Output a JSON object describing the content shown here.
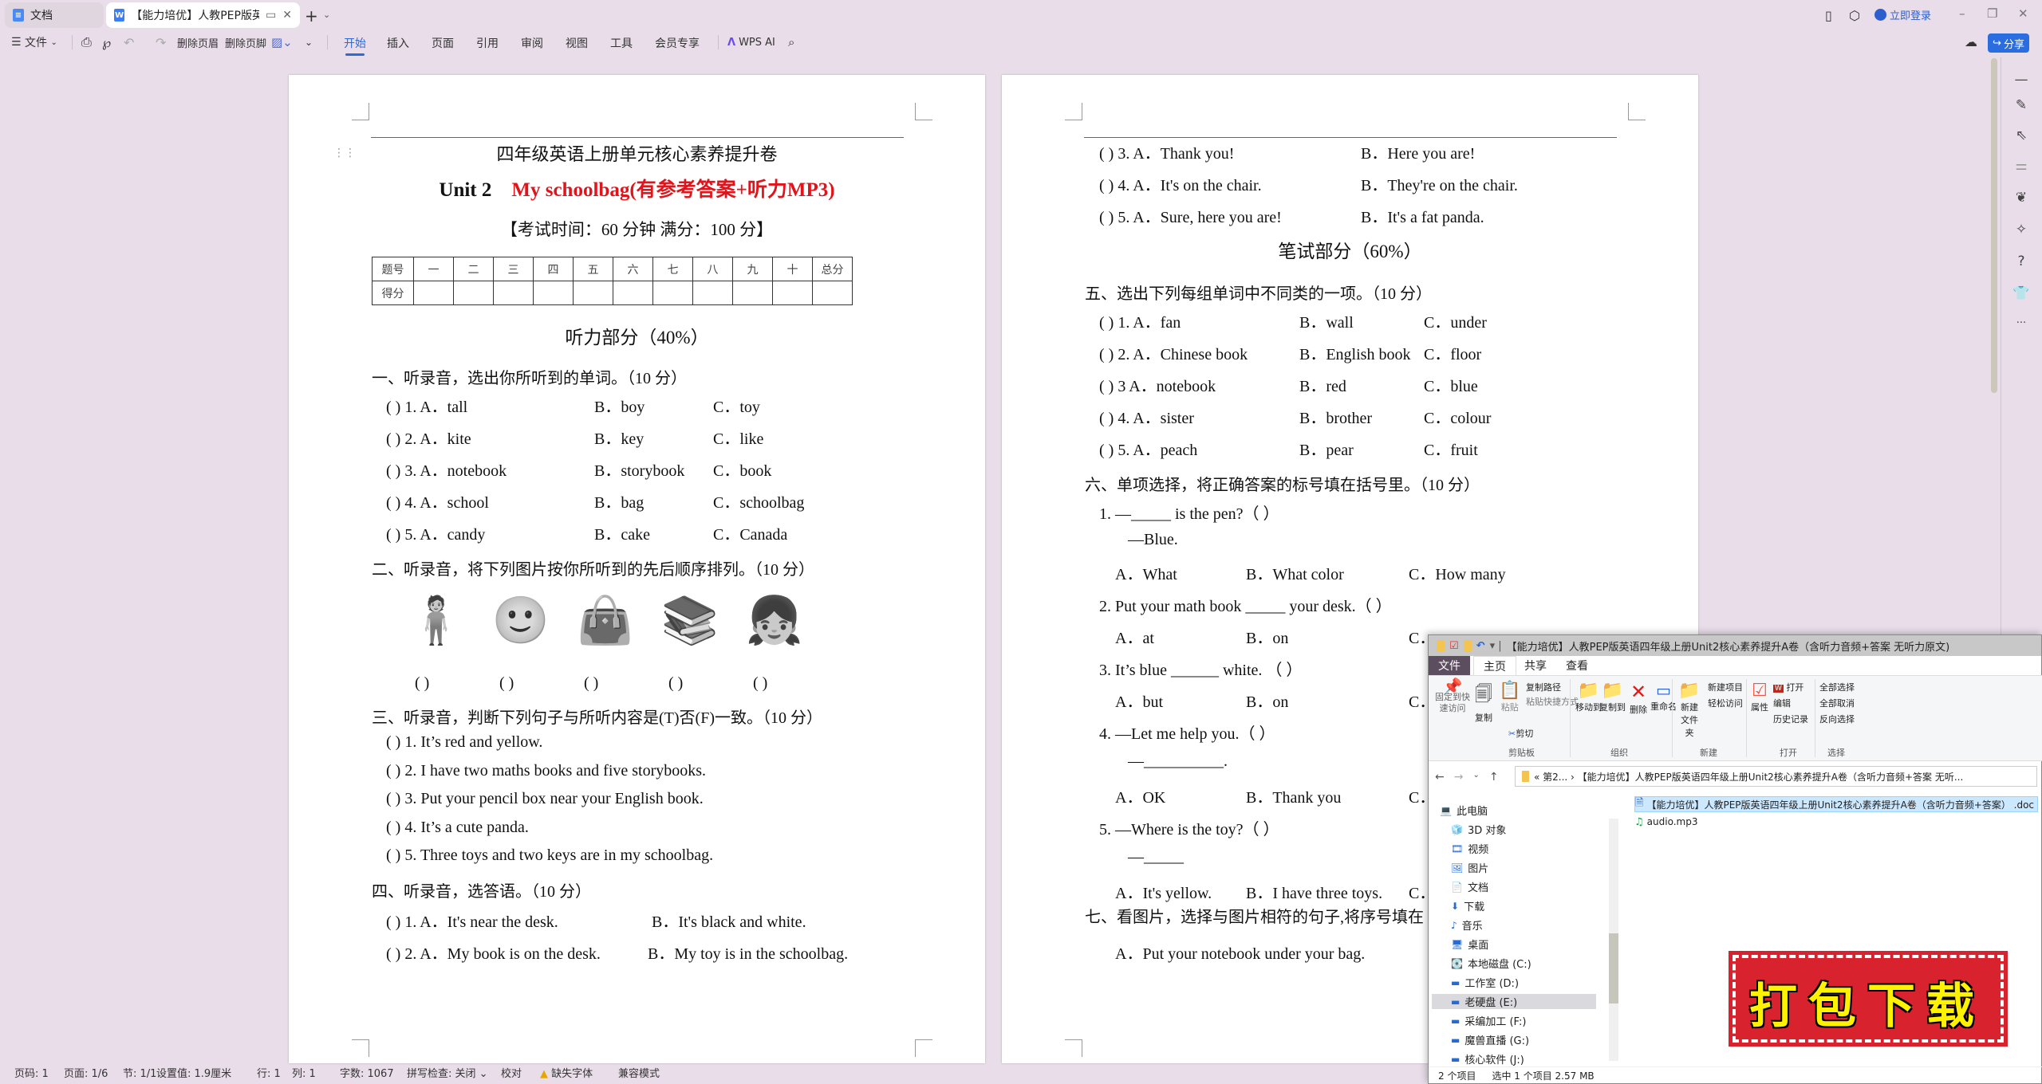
{
  "tabs": [
    {
      "label": "文档",
      "icon": "docs-icon"
    },
    {
      "label": "【能力培优】人教PEP版英语四",
      "icon": "wps-word-icon"
    }
  ],
  "titlebar": {
    "login": "立即登录",
    "share": "分享"
  },
  "toolbar": {
    "file_menu": "文件",
    "delete_header": "删除页眉",
    "delete_footer": "删除页脚",
    "menus": [
      "开始",
      "插入",
      "页面",
      "引用",
      "审阅",
      "视图",
      "工具",
      "会员专享"
    ],
    "active_menu": "开始",
    "wps_ai": "WPS AI"
  },
  "page1": {
    "title": "四年级英语上册单元核心素养提升卷",
    "unit_black": "Unit 2",
    "unit_red": "My    schoolbag(有参考答案+听力MP3)",
    "exam_info": "【考试时间：60 分钟  满分：100 分】",
    "score_table": {
      "headers": [
        "题号",
        "一",
        "二",
        "三",
        "四",
        "五",
        "六",
        "七",
        "八",
        "九",
        "十",
        "总分"
      ],
      "row_label": "得分"
    },
    "listening_heading": "听力部分（40%）",
    "sec1": "一、听录音，选出你所听到的单词。（10 分）",
    "sec1_items": [
      {
        "n": "(      ) 1. A．tall",
        "b": "B．boy",
        "c": "C．toy"
      },
      {
        "n": "(      ) 2. A．kite",
        "b": "B．key",
        "c": "C．like"
      },
      {
        "n": "(      ) 3. A．notebook",
        "b": "B．storybook",
        "c": "C．book"
      },
      {
        "n": "(      ) 4. A．school",
        "b": "B．bag",
        "c": "C．schoolbag"
      },
      {
        "n": "(      ) 5. A．candy",
        "b": "B．cake",
        "c": "C．Canada"
      }
    ],
    "sec2": "二、听录音，将下列图片按你所听到的先后顺序排列。（10 分）",
    "sec2_pictures": [
      "boy-at-desk",
      "boy-face",
      "schoolbag",
      "books-and-pencils",
      "girl-at-desk"
    ],
    "sec2_brackets": "(      )",
    "sec3": "三、听录音，判断下列句子与所听内容是(T)否(F)一致。（10 分）",
    "sec3_items": [
      "(      ) 1. It’s red and yellow.",
      "(      ) 2. I have two maths books and five storybooks.",
      "(      ) 3. Put your pencil box near your English book.",
      "(      ) 4. It’s a cute panda.",
      "(      ) 5. Three toys and two keys are in my schoolbag."
    ],
    "sec4": "四、听录音，选答语。（10 分）",
    "sec4_items": [
      {
        "a": "(      ) 1. A．It's near the desk.",
        "b": "B．It's black and white."
      },
      {
        "a": "(      ) 2. A．My book is on the desk.",
        "b": "B．My toy is in the schoolbag."
      }
    ]
  },
  "page2": {
    "top_items": [
      {
        "a": "(      ) 3. A．Thank you!",
        "b": "B．Here you are!"
      },
      {
        "a": "(      ) 4. A．It's on the chair.",
        "b": "B．They're on the chair."
      },
      {
        "a": "(      ) 5. A．Sure, here you are!",
        "b": "B．It's a fat panda."
      }
    ],
    "written_heading": "笔试部分（60%）",
    "sec5": "五、选出下列每组单词中不同类的一项。（10 分）",
    "sec5_items": [
      {
        "a": "(      ) 1. A．fan",
        "b": "B．wall",
        "c": "C．under"
      },
      {
        "a": "(      ) 2. A．Chinese book",
        "b": "B．English book",
        "c": "C．floor"
      },
      {
        "a": "(      ) 3 A．notebook",
        "b": "B．red",
        "c": "C．blue"
      },
      {
        "a": "(      ) 4. A．sister",
        "b": "B．brother",
        "c": "C．colour"
      },
      {
        "a": "(      ) 5. A．peach",
        "b": "B．pear",
        "c": "C．fruit"
      }
    ],
    "sec6": "六、单项选择，将正确答案的标号填在括号里。（10 分）",
    "sec6_lines": [
      "1.    —_____ is the pen?（      ）",
      "—Blue.",
      "2.    Put your math book _____ your desk.（      ）",
      "3.    It’s blue ______ white.  （      ）",
      "4.    —Let me help you.（      ）",
      "—__________.",
      "5.    —Where is the toy?（      ）",
      "—_____"
    ],
    "sec6_options": [
      {
        "a": "A．What",
        "b": "B．What color",
        "c": "C．How many"
      },
      {
        "a": "A．at",
        "b": "B．on",
        "c": "C．"
      },
      {
        "a": "A．but",
        "b": "B．on",
        "c": "C．"
      },
      {
        "a": "A．OK",
        "b": "B．Thank you",
        "c": "C．"
      },
      {
        "a": "A．It's yellow.",
        "b": "B．I have three toys.",
        "c": "C．"
      }
    ],
    "sec7": "七、看图片，选择与图片相符的句子,将序号填在",
    "sec7_item": "A．Put your notebook under your bag."
  },
  "explorer": {
    "title": "【能力培优】人教PEP版英语四年级上册Unit2核心素养提升A卷（含听力音频+答案 无听力原文)",
    "ribbon_tabs": [
      "文件",
      "主页",
      "共享",
      "查看"
    ],
    "clipboard": {
      "pin": "固定到快速访问",
      "copy": "复制",
      "paste": "粘贴",
      "copy_path": "复制路径",
      "paste_shortcut": "粘贴快捷方式",
      "cut": "剪切",
      "group": "剪贴板"
    },
    "organize": {
      "move_to": "移动到",
      "copy_to": "复制到",
      "delete": "删除",
      "rename": "重命名",
      "group": "组织"
    },
    "new": {
      "new_folder": "新建文件夹",
      "new_item": "新建项目",
      "easy_access": "轻松访问",
      "group": "新建"
    },
    "open": {
      "properties": "属性",
      "open": "打开",
      "edit": "编辑",
      "history": "历史记录",
      "group": "打开"
    },
    "select": {
      "select_all": "全部选择",
      "select_none": "全部取消",
      "invert": "反向选择",
      "group": "选择"
    },
    "address": "«  第2...  ›  【能力培优】人教PEP版英语四年级上册Unit2核心素养提升A卷（含听力音频+答案 无听...",
    "nav": [
      "此电脑",
      "3D 对象",
      "视频",
      "图片",
      "文档",
      "下载",
      "音乐",
      "桌面",
      "本地磁盘 (C:)",
      "工作室 (D:)",
      "老硬盘 (E:)",
      "采编加工 (F:)",
      "魔兽直播 (G:)",
      "核心软件 (J:)"
    ],
    "selected_nav": "老硬盘 (E:)",
    "files": [
      {
        "name": "【能力培优】人教PEP版英语四年级上册Unit2核心素养提升A卷（含听力音频+答案） .doc",
        "selected": true
      },
      {
        "name": "audio.mp3",
        "selected": false
      }
    ],
    "status_count": "2 个项目",
    "status_selected": "选中 1 个项目  2.57 MB"
  },
  "stamp": {
    "text": "打包下载",
    "color": "#d8222e",
    "text_color": "#fff200"
  },
  "statusbar": [
    "页码: 1",
    "页面: 1/6",
    "节: 1/1",
    "设置值: 1.9厘米",
    "行: 1",
    "列: 1",
    "字数: 1067",
    "拼写检查: 关闭",
    "校对",
    "缺失字体",
    "兼容模式"
  ]
}
